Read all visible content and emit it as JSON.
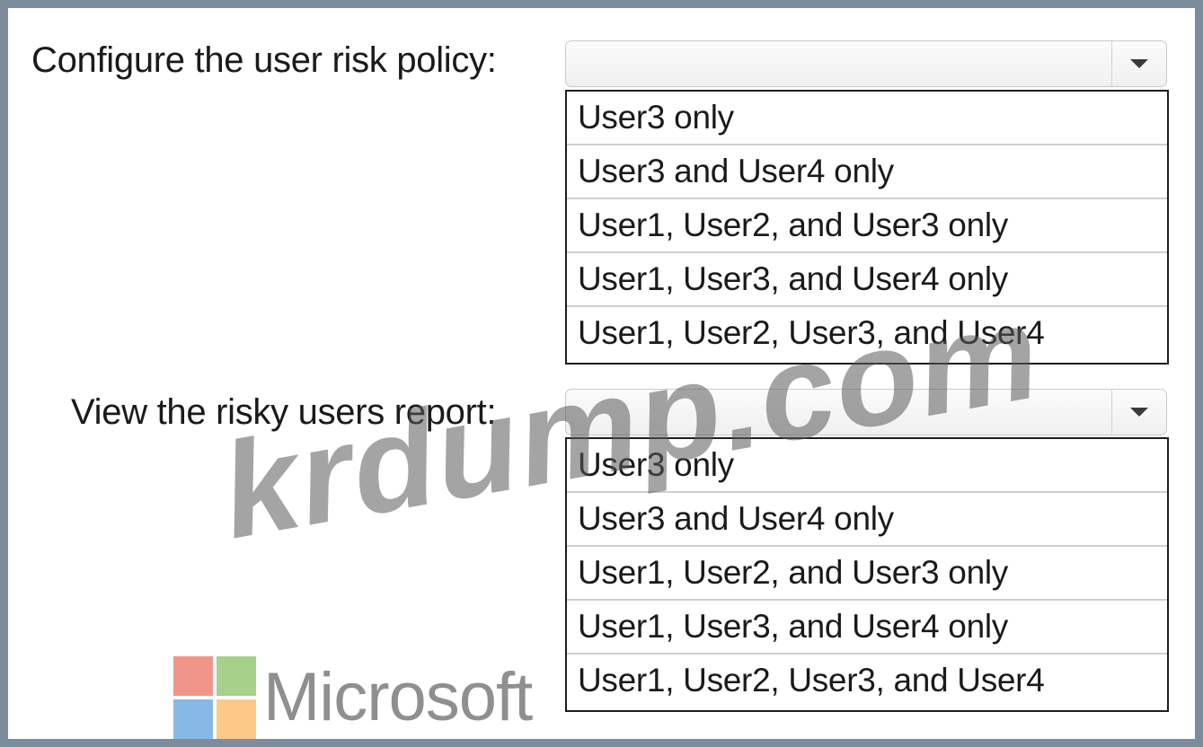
{
  "questions": [
    {
      "label": "Configure the user risk policy:",
      "selected": "",
      "options": [
        "User3 only",
        "User3 and User4 only",
        "User1, User2, and User3 only",
        "User1, User3, and User4 only",
        "User1, User2, User3, and User4"
      ]
    },
    {
      "label": "View the risky users report:",
      "selected": "",
      "options": [
        "User3 only",
        "User3 and User4 only",
        "User1, User2, and User3 only",
        "User1, User3, and User4 only",
        "User1, User2, User3, and User4"
      ]
    }
  ],
  "watermark_text": "krdump.com",
  "brand": {
    "name": "Microsoft",
    "logo_colors": [
      "#f1948a",
      "#a8d08d",
      "#8ab8e6",
      "#fdc98a"
    ]
  },
  "colors": {
    "frame": "#7d8c9c",
    "panel": "#ffffff"
  }
}
